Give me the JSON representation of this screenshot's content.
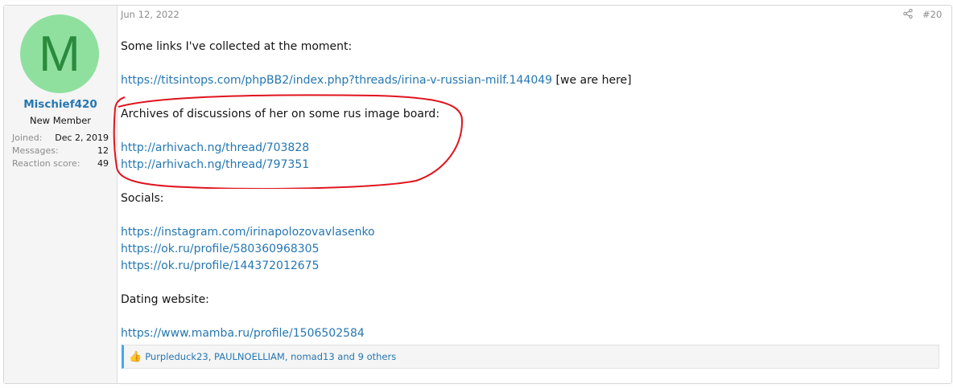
{
  "user": {
    "avatar_letter": "M",
    "name": "Mischief420",
    "title": "New Member",
    "stats": [
      {
        "label": "Joined:",
        "value": "Dec 2, 2019"
      },
      {
        "label": "Messages:",
        "value": "12"
      },
      {
        "label": "Reaction score:",
        "value": "49"
      }
    ]
  },
  "post": {
    "date": "Jun 12, 2022",
    "number": "#20",
    "intro": "Some links I've collected at the moment:",
    "thread_link": "https://titsintops.com/phpBB2/index.php?threads/irina-v-russian-milf.144049",
    "thread_note": " [we are here]",
    "archives_heading": "Archives of discussions of her on some rus image board:",
    "archive_links": [
      "http://arhivach.ng/thread/703828",
      "http://arhivach.ng/thread/797351"
    ],
    "socials_heading": "Socials:",
    "social_links": [
      "https://instagram.com/irinapolozovavlasenko",
      "https://ok.ru/profile/580360968305",
      "https://ok.ru/profile/144372012675"
    ],
    "dating_heading": "Dating website:",
    "dating_link": "https://www.mamba.ru/profile/1506502584"
  },
  "reactions": {
    "text": "Purpleduck23, PAULNOELLIAM, nomad13 and 9 others"
  },
  "colors": {
    "link": "#2577b1",
    "avatar_bg": "#8fe09f",
    "avatar_letter": "#2a8a3d",
    "highlight": "#e0141e"
  }
}
